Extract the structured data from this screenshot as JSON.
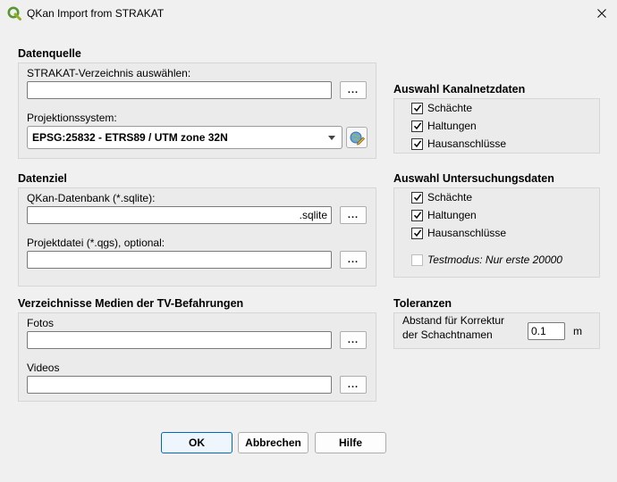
{
  "window": {
    "title": "QKan Import from STRAKAT",
    "icon": "qgis-icon",
    "close_icon": "close-icon"
  },
  "datenquelle": {
    "title": "Datenquelle",
    "dir_label": "STRAKAT-Verzeichnis auswählen:",
    "dir_value": "",
    "dir_button": "...",
    "proj_label": "Projektionssystem:",
    "proj_value": "EPSG:25832 - ETRS89 / UTM zone 32N"
  },
  "datenziel": {
    "title": "Datenziel",
    "db_label": "QKan-Datenbank (*.sqlite):",
    "db_value": ".sqlite",
    "db_button": "...",
    "proj_label": "Projektdatei (*.qgs), optional:",
    "proj_value": "",
    "proj_button": "..."
  },
  "medien": {
    "title": "Verzeichnisse Medien der TV-Befahrungen",
    "fotos_label": "Fotos",
    "fotos_value": "",
    "fotos_button": "...",
    "videos_label": "Videos",
    "videos_value": "",
    "videos_button": "..."
  },
  "kanalnetz": {
    "title": "Auswahl Kanalnetzdaten",
    "items": [
      {
        "label": "Schächte",
        "checked": true
      },
      {
        "label": "Haltungen",
        "checked": true
      },
      {
        "label": "Hausanschlüsse",
        "checked": true
      }
    ]
  },
  "untersuchung": {
    "title": "Auswahl Untersuchungsdaten",
    "items": [
      {
        "label": "Schächte",
        "checked": true
      },
      {
        "label": "Haltungen",
        "checked": true
      },
      {
        "label": "Hausanschlüsse",
        "checked": true
      }
    ],
    "testmodus": {
      "label": "Testmodus: Nur erste 20000",
      "checked": false
    }
  },
  "toleranzen": {
    "title": "Toleranzen",
    "label_line1": "Abstand für Korrektur",
    "label_line2": "der Schachtnamen",
    "value": "0.1",
    "unit": "m"
  },
  "buttons": {
    "ok": "OK",
    "cancel": "Abbrechen",
    "help": "Hilfe"
  }
}
